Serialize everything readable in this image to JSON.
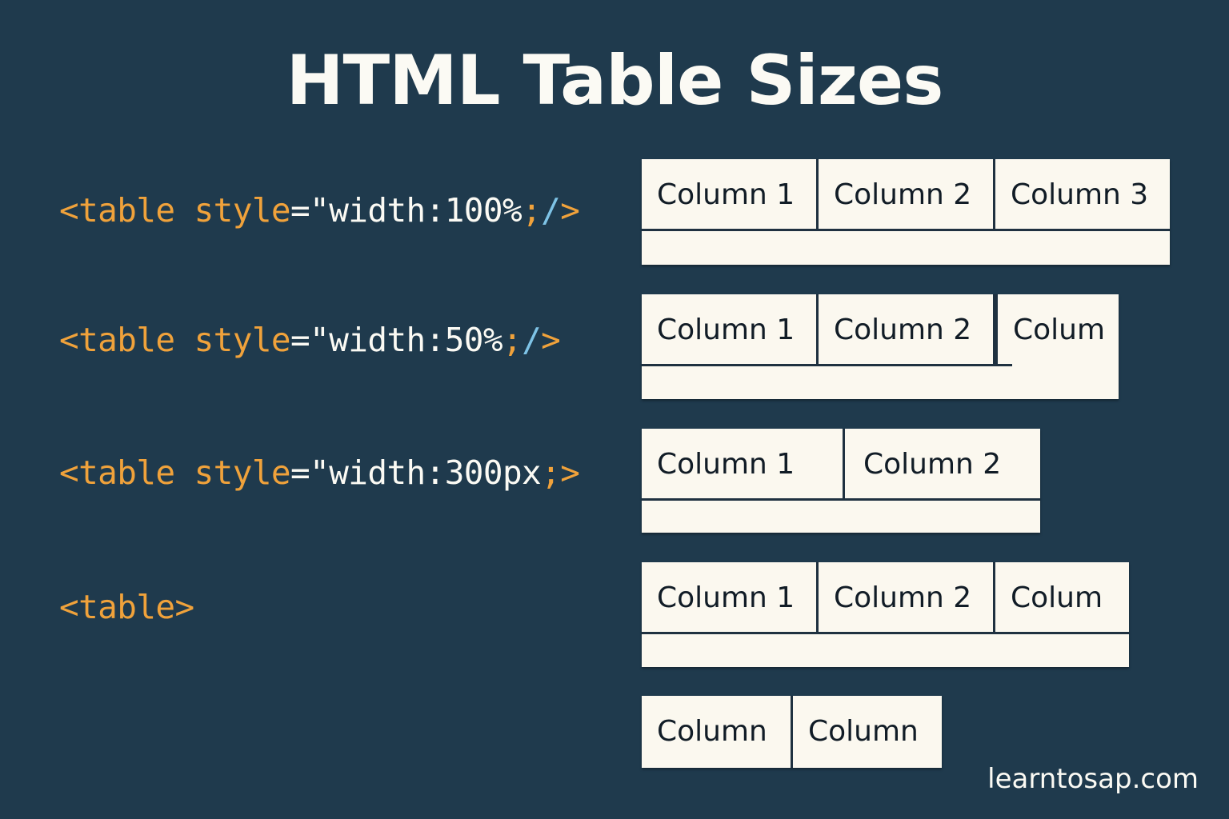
{
  "title": "HTML Table Sizes",
  "colors": {
    "background": "#1f3a4d",
    "code_keyword": "#f0a23b",
    "code_slash": "#7ec3e6",
    "text_light": "#fbfaf4",
    "table_fill": "#fbf8ef",
    "table_border": "#1f3140"
  },
  "examples": [
    {
      "code": {
        "open": "<table",
        "attr": " style",
        "eq": "=",
        "value": "\"width:100%",
        "semi": ";",
        "slash": "/",
        "close": ">"
      },
      "headers": [
        "Column 1",
        "Column 2",
        "Column 3"
      ]
    },
    {
      "code": {
        "open": "<table",
        "attr": " style",
        "eq": "=",
        "value": "\"width:50%",
        "semi": ";",
        "slash": "/",
        "close": ">"
      },
      "headers": [
        "Column 1",
        "Column 2",
        "Colum"
      ]
    },
    {
      "code": {
        "open": "<table",
        "attr": " style",
        "eq": "=",
        "value": "\"width:300px",
        "semi": ";",
        "slash": "",
        "close": ">"
      },
      "headers": [
        "Column 1",
        "Column 2"
      ]
    },
    {
      "code": {
        "open": "<table",
        "attr": "",
        "eq": "",
        "value": "",
        "semi": "",
        "slash": "",
        "close": ">"
      },
      "headers": [
        "Column 1",
        "Column 2",
        "Colum"
      ]
    },
    {
      "code": null,
      "headers": [
        "Column",
        "Column"
      ]
    }
  ],
  "watermark": "learntosap.com"
}
